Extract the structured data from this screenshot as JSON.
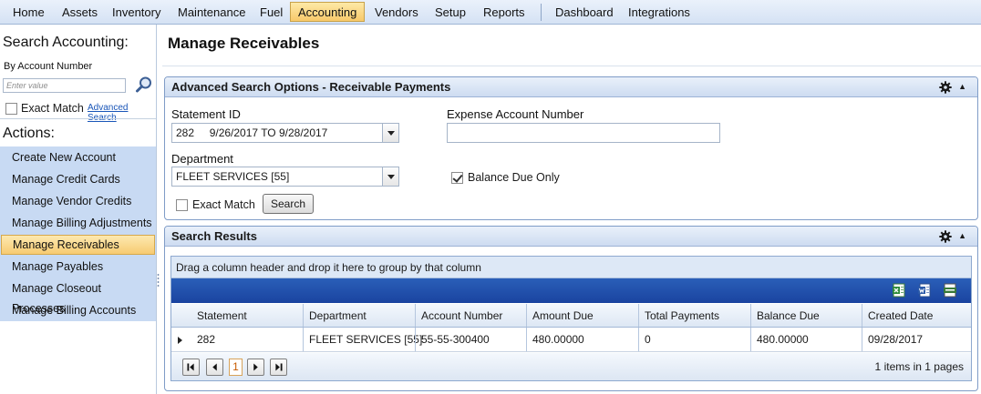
{
  "menu": {
    "items": [
      "Home",
      "Assets",
      "Inventory",
      "Maintenance",
      "Fuel",
      "Accounting",
      "Vendors",
      "Setup",
      "Reports"
    ],
    "items_right": [
      "Dashboard",
      "Integrations"
    ],
    "active": "Accounting",
    "active_color": "#f8c96a"
  },
  "sidebar": {
    "search_heading": "Search Accounting:",
    "search_by": "By Account Number",
    "search_placeholder": "Enter value",
    "search_icon": "magnifier-icon",
    "exact_match_label": "Exact Match",
    "advanced_search_link": "Advanced Search",
    "actions_heading": "Actions:",
    "actions": [
      "Create New Account",
      "Manage Credit Cards",
      "Manage Vendor Credits",
      "Manage Billing Adjustments",
      "Manage Receivables",
      "Manage Payables",
      "Manage Closeout Processes",
      "Manage Billing Accounts"
    ],
    "active_action": "Manage Receivables",
    "list_color": "#c8daf3"
  },
  "main": {
    "title": "Manage Receivables",
    "search_panel": {
      "title": "Advanced Search Options - Receivable Payments",
      "statement_id_label": "Statement ID",
      "statement_id_value": "282     9/26/2017 TO 9/28/2017",
      "expense_account_label": "Expense Account Number",
      "expense_account_value": "",
      "department_label": "Department",
      "department_value": "FLEET SERVICES [55]",
      "balance_due_only_label": "Balance Due Only",
      "balance_due_only_checked": true,
      "exact_match_label": "Exact Match",
      "exact_match_checked": false,
      "search_button": "Search"
    },
    "results_panel": {
      "title": "Search Results",
      "group_hint": "Drag a column header and drop it here to group by that column",
      "export_icons": [
        "excel-export-icon",
        "word-export-icon",
        "csv-export-icon"
      ],
      "columns": [
        "Statement",
        "Department",
        "Account Number",
        "Amount Due",
        "Total Payments",
        "Balance Due",
        "Created Date"
      ],
      "rows": [
        [
          "282",
          "FLEET SERVICES [55]",
          "55-55-300400",
          "480.00000",
          "0",
          "480.00000",
          "09/28/2017"
        ]
      ],
      "pager": {
        "current_page": "1",
        "items_count": "1",
        "pages_count": "1",
        "items_in_text": "items in",
        "pages_text": "pages"
      }
    }
  }
}
